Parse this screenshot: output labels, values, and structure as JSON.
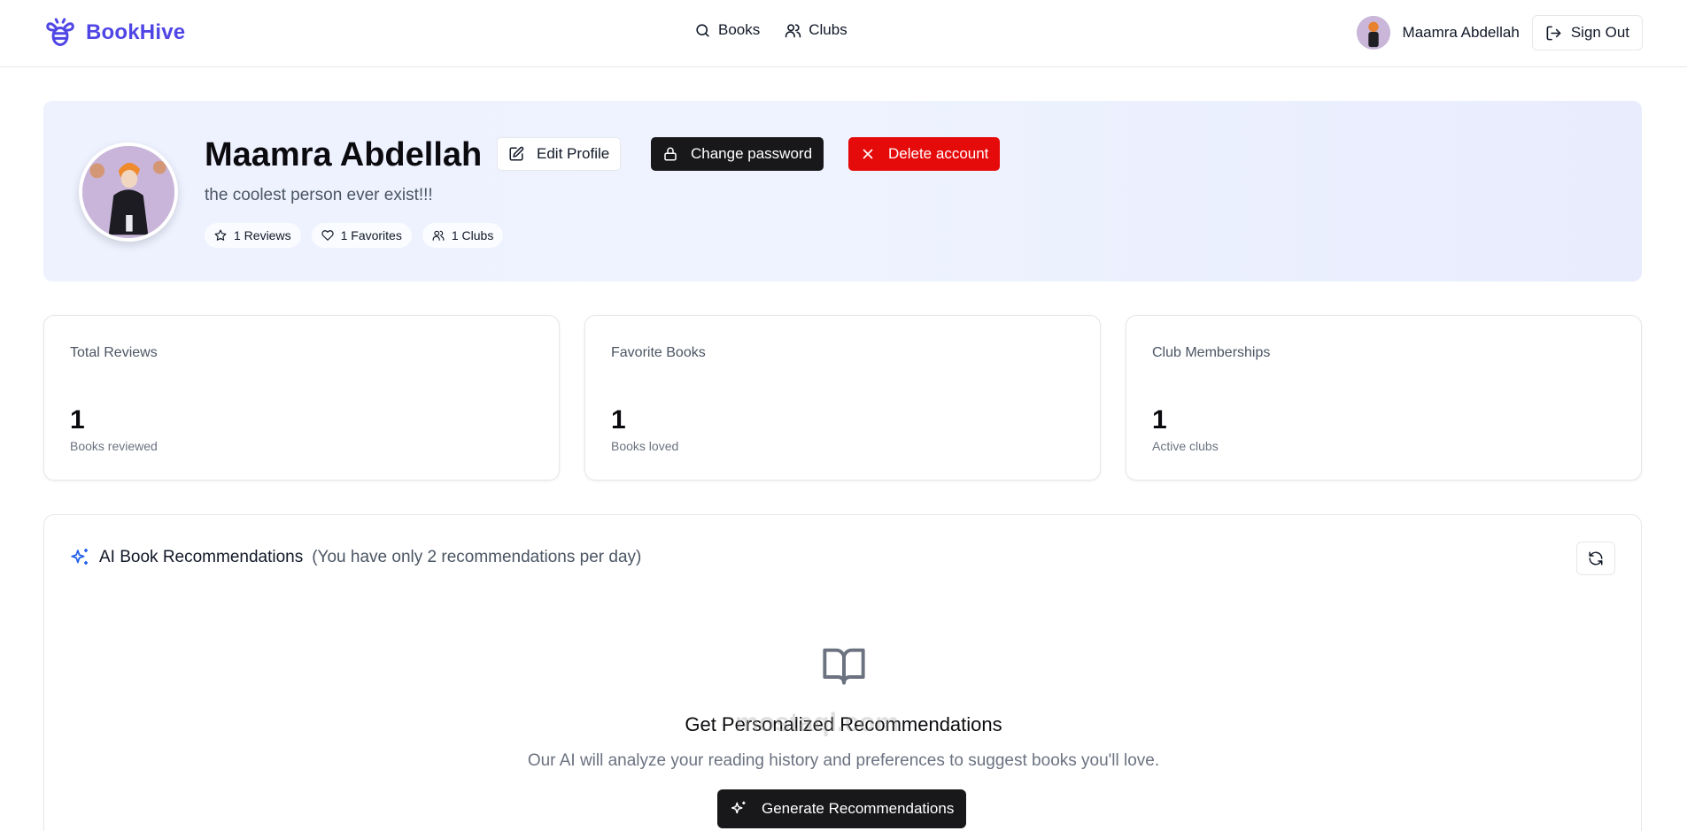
{
  "header": {
    "logo_text": "BookHive",
    "nav": [
      {
        "label": "Books",
        "icon": "search-icon"
      },
      {
        "label": "Clubs",
        "icon": "users-icon"
      }
    ],
    "user_name": "Maamra Abdellah",
    "sign_out_label": "Sign Out"
  },
  "profile": {
    "name": "Maamra Abdellah",
    "bio": "the coolest person ever exist!!!",
    "edit_label": "Edit Profile",
    "change_password_label": "Change password",
    "delete_label": "Delete account",
    "pills": [
      {
        "label": "1 Reviews",
        "icon": "star-icon"
      },
      {
        "label": "1 Favorites",
        "icon": "heart-icon"
      },
      {
        "label": "1 Clubs",
        "icon": "users-icon"
      }
    ]
  },
  "cards": [
    {
      "title": "Total Reviews",
      "value": "1",
      "sub": "Books reviewed"
    },
    {
      "title": "Favorite Books",
      "value": "1",
      "sub": "Books loved"
    },
    {
      "title": "Club Memberships",
      "value": "1",
      "sub": "Active clubs"
    }
  ],
  "recommendations": {
    "title": "AI Book Recommendations",
    "note": "(You have only 2 recommendations per day)",
    "empty_title": "Get Personalized Recommendations",
    "empty_text": "Our AI will analyze your reading history and preferences to suggest books you'll love.",
    "generate_label": "Generate Recommendations"
  },
  "watermark": "mostaql.com",
  "colors": {
    "brand": "#4f46e5",
    "danger": "#e60b0b",
    "dark": "#18181b",
    "sparkle": "#2563eb"
  }
}
